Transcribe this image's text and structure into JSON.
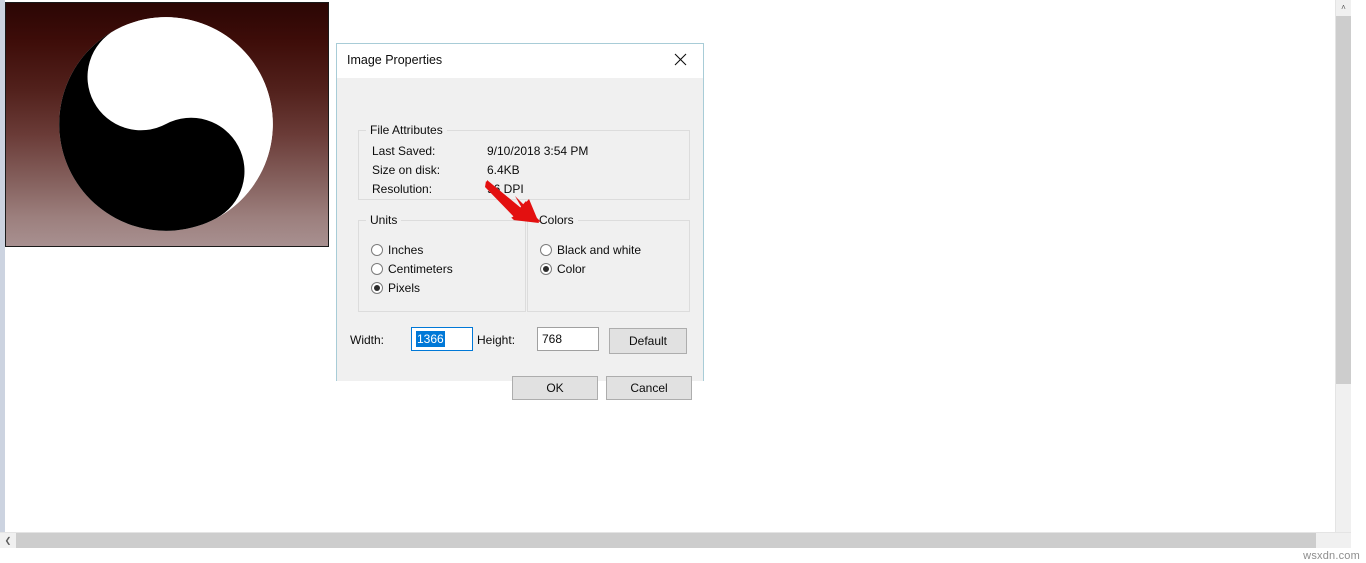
{
  "window": {
    "watermark": "wsxdn.com",
    "scrollbars": {
      "vertical_up_arrow": "˄",
      "vertical_down_arrow": "˅",
      "horizontal_left_arrow": "❮"
    }
  },
  "image_canvas": {
    "name": "yin-yang-symbol",
    "background_gradient_top": "#2b0604",
    "background_gradient_bottom": "#a89090",
    "symbol_dark_color": "#000000",
    "symbol_light_color": "#ffffff"
  },
  "dialog": {
    "title": "Image Properties",
    "close_icon": "close-icon",
    "file_attributes": {
      "legend": "File Attributes",
      "rows": [
        {
          "label": "Last Saved:",
          "value": "9/10/2018 3:54 PM"
        },
        {
          "label": "Size on disk:",
          "value": "6.4KB"
        },
        {
          "label": "Resolution:",
          "value": "96 DPI"
        }
      ]
    },
    "units": {
      "legend": "Units",
      "options": [
        {
          "label": "Inches",
          "selected": false
        },
        {
          "label": "Centimeters",
          "selected": false
        },
        {
          "label": "Pixels",
          "selected": true
        }
      ]
    },
    "colors": {
      "legend": "Colors",
      "options": [
        {
          "label": "Black and white",
          "selected": false
        },
        {
          "label": "Color",
          "selected": true
        }
      ]
    },
    "size": {
      "width_label": "Width:",
      "width_value": "1366",
      "height_label": "Height:",
      "height_value": "768",
      "default_button": "Default"
    },
    "actions": {
      "ok": "OK",
      "cancel": "Cancel"
    },
    "accent_focus_color": "#0078d7",
    "border_color": "#a8ccd7"
  },
  "annotation": {
    "arrow_color": "#e31010",
    "points_at": "Black and white"
  }
}
